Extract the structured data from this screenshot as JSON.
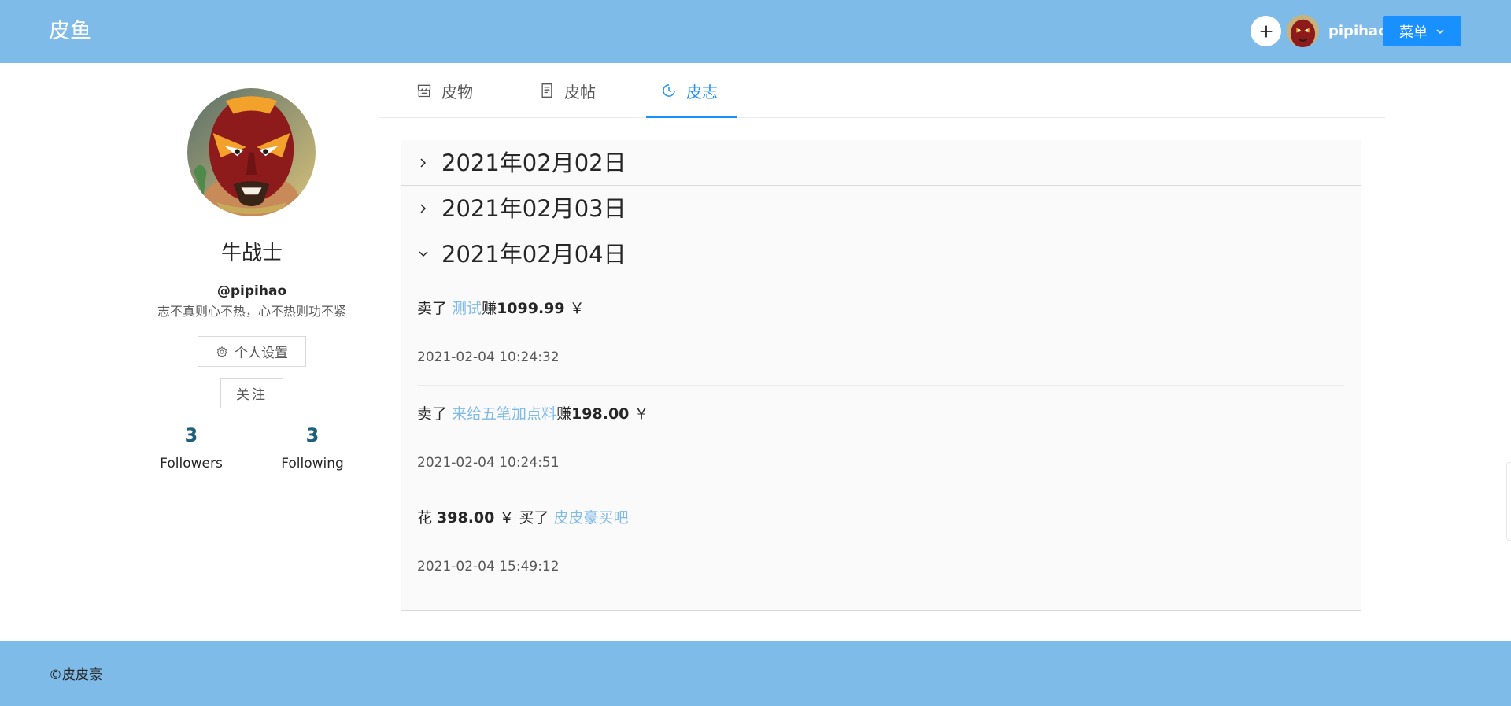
{
  "header": {
    "brand": "皮鱼",
    "username": "pipihao",
    "menu_label": "菜单",
    "icons": {
      "add": "plus-icon",
      "menu_caret": "chevron-down-icon"
    }
  },
  "profile": {
    "display_name": "牛战士",
    "handle": "@pipihao",
    "bio": "志不真则心不热，心不热则功不紧",
    "settings_label": "个人设置",
    "follow_label": "关注",
    "stats": [
      {
        "value": "3",
        "label": "Followers"
      },
      {
        "value": "3",
        "label": "Following"
      }
    ]
  },
  "tabs": [
    {
      "label": "皮物",
      "icon": "shop-icon",
      "active": false
    },
    {
      "label": "皮帖",
      "icon": "file-text-icon",
      "active": false
    },
    {
      "label": "皮志",
      "icon": "clock-icon",
      "active": true
    }
  ],
  "timeline": {
    "panels": [
      {
        "date": "2021年02月02日",
        "expanded": false
      },
      {
        "date": "2021年02月03日",
        "expanded": false
      },
      {
        "date": "2021年02月04日",
        "expanded": true,
        "entries": [
          {
            "pre": "卖了 ",
            "link": "测试",
            "mid": "赚",
            "amount": "1099.99",
            "post": " ￥",
            "time": "2021-02-04 10:24:32"
          },
          {
            "pre": "卖了 ",
            "link": "来给五笔加点料",
            "mid": "赚",
            "amount": "198.00",
            "post": " ￥",
            "time": "2021-02-04 10:24:51"
          },
          {
            "pre": "花 ",
            "amount": "398.00",
            "mid2": " ￥ 买了 ",
            "link": "皮皮豪买吧",
            "time": "2021-02-04 15:49:12"
          }
        ]
      }
    ]
  },
  "footer": {
    "copyright": "©皮皮豪"
  },
  "colors": {
    "header_bg": "#7fbbe9",
    "primary": "#1890ff",
    "link": "#7fbbe9",
    "stat": "#1f5f7a"
  }
}
